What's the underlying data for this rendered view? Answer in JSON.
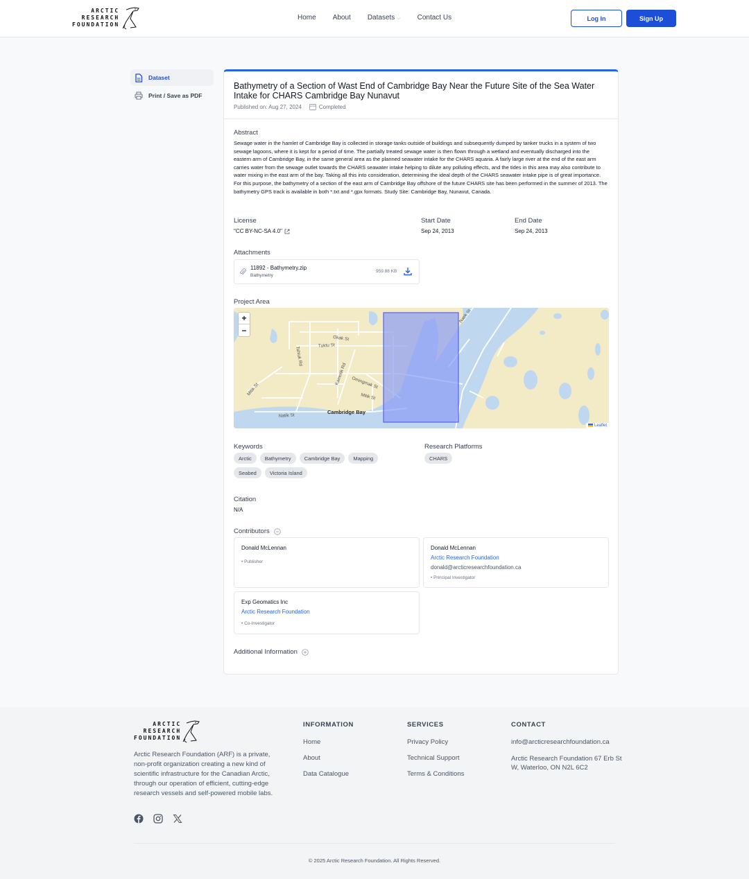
{
  "brand": {
    "line1": "ARCTIC",
    "line2": "RESEARCH",
    "line3": "FOUNDATION"
  },
  "nav": {
    "items": [
      "Home",
      "About",
      "Datasets",
      "Contact Us"
    ],
    "login": "Log In",
    "signup": "Sign Up"
  },
  "sidebar": {
    "items": [
      {
        "label": "Dataset",
        "icon": "document-icon",
        "active": true
      },
      {
        "label": "Print / Save as PDF",
        "icon": "printer-icon",
        "active": false
      }
    ]
  },
  "dataset": {
    "title": "Bathymetry of a Section of Wast End of Cambridge Bay Near the Future Site of the Sea Water Intake for CHARS Cambridge Bay Nunavut",
    "published": "Published on: Aug 27, 2024",
    "status": "Completed",
    "abstract_label": "Abstract",
    "abstract": "Sewage water in the hamlet of Cambridge Bay is collected in storage tanks outside of buildings and subsequently dumped by tanker trucks in a system of two sewage lagoons, where it is kept for a period of time. The partially treated sewage water is then flown through a wetland and eventually discharged into the eastern arm of Cambridge Bay, in the same general area as the planned seawater intake for the CHARS aquaria. A fairly large river at the end of the east arm carries water from the sewage outlet towards the CHARS seawater intake helping to dilute any polluting effects, and the tides in this area may also contribute to water mixing in the east arm of the bay. Taking all this into consideration, determining the ideal depth of the CHARS seawater intake pipe is of great importance. For this purpose, the bathymetry of a section of the east arm of Cambridge Bay offshore of the future CHARS site has been performed in the summer of 2013. The bathymetry GPS track is available in both *.txt and *.gpx formats. Study Site: Cambridge Bay, Nunavut, Canada.",
    "license_label": "License",
    "license": "\"CC BY-NC-SA 4.0\"",
    "start_label": "Start Date",
    "start": "Sep 24, 2013",
    "end_label": "End Date",
    "end": "Sep 24, 2013",
    "attachments_label": "Attachments",
    "attachment": {
      "name": "11892 - Bathymetry.zip",
      "type": "Bathymetry",
      "size": "959.88 KB"
    },
    "project_area_label": "Project Area",
    "map": {
      "streets": [
        "Okak St",
        "Tuktu St",
        "Tahiuk Rd",
        "Kamotik Rd",
        "Omingmak St",
        "Mitik St",
        "Mitik St",
        "Natik St",
        "Natik St"
      ],
      "place": "Cambridge Bay",
      "zoom_in": "+",
      "zoom_out": "−",
      "attribution": "Leaflet"
    },
    "keywords_label": "Keywords",
    "keywords": [
      "Arctic",
      "Bathymetry",
      "Cambridge Bay",
      "Mapping",
      "Seabed",
      "Victoria Island"
    ],
    "platforms_label": "Research Platforms",
    "platforms": [
      "CHARS"
    ],
    "citation_label": "Citation",
    "citation": "N/A",
    "contributors_label": "Contributors",
    "contributors": [
      {
        "name": "Donald McLennan",
        "org": "",
        "email": "",
        "role": "• Publisher"
      },
      {
        "name": "Donald McLennan",
        "org": "Arctic Research Foundation",
        "email": "donald@arcticresearchfoundation.ca",
        "role": "• Principal Investigator"
      },
      {
        "name": "Exp Geomatics Inc",
        "org": "Arctic Research Foundation",
        "email": "",
        "role": "• Co-Investigator"
      }
    ],
    "additional_label": "Additional Information"
  },
  "footer": {
    "description": "Arctic Research Foundation (ARF) is a private, non-profit organization creating a new kind of scientific infrastructure for the Canadian Arctic, through our operation of efficient, cutting-edge research vessels and self-powered mobile labs.",
    "information": {
      "title": "INFORMATION",
      "links": [
        "Home",
        "About",
        "Data Catalogue"
      ]
    },
    "services": {
      "title": "SERVICES",
      "links": [
        "Privacy Policy",
        "Technical Support",
        "Terms & Conditions"
      ]
    },
    "contact": {
      "title": "CONTACT",
      "email": "info@arcticresearchfoundation.ca",
      "address": "Arctic Research Foundation 67 Erb St W, Waterloo, ON N2L 6C2"
    },
    "social": [
      "facebook-icon",
      "instagram-icon",
      "x-icon"
    ],
    "copyright": "© 2025 Arctic Research Foundation. All Rights Reserved."
  },
  "colors": {
    "accent": "#1d4ed8",
    "link": "#2563eb",
    "map_land": "#f2ebc6",
    "map_water": "#bfd8ef",
    "bbox_fill": "#8c9cf5"
  }
}
